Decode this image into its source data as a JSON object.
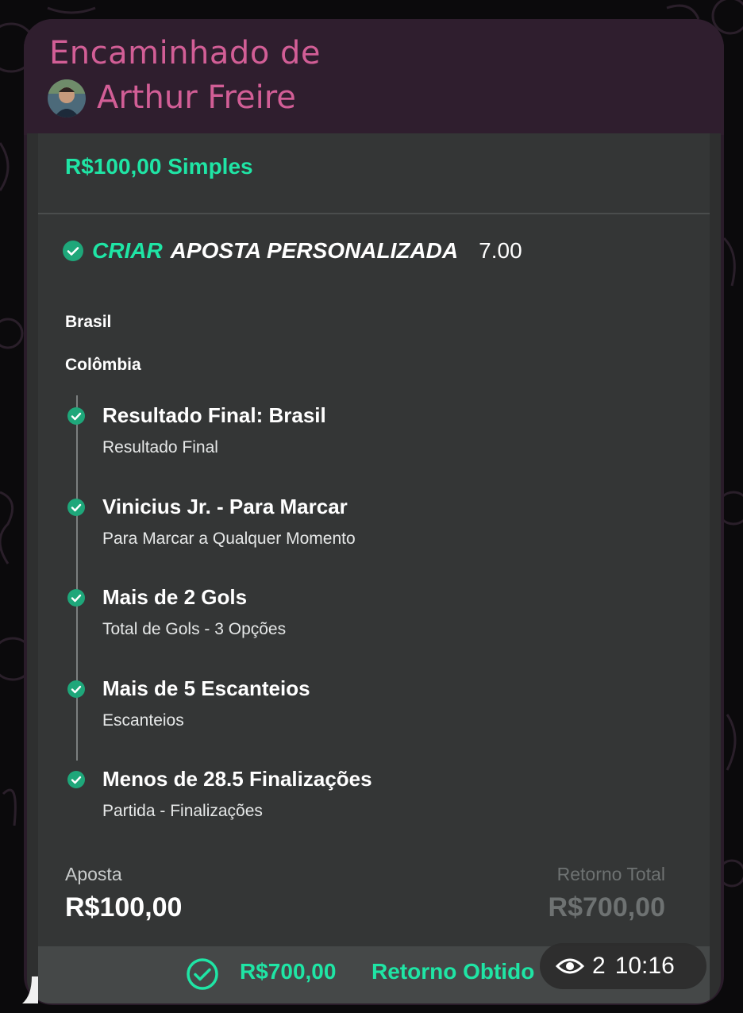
{
  "forward": {
    "label": "Encaminhado de",
    "author": "Arthur Freire",
    "avatar_icon": "user-avatar-photo"
  },
  "bet": {
    "stake_header": "R$100,00 Simples",
    "builder_prefix": "CRIAR",
    "builder_title": "APOSTA PERSONALIZADA",
    "odds": "7.00",
    "teams": [
      "Brasil",
      "Colômbia"
    ],
    "legs": [
      {
        "title": "Resultado Final: Brasil",
        "market": "Resultado Final"
      },
      {
        "title": "Vinicius Jr. - Para Marcar",
        "market": "Para Marcar a Qualquer Momento"
      },
      {
        "title": "Mais de 2 Gols",
        "market": "Total de Gols - 3 Opções"
      },
      {
        "title": "Mais de 5 Escanteios",
        "market": "Escanteios"
      },
      {
        "title": "Menos de 28.5 Finalizações",
        "market": "Partida - Finalizações"
      }
    ],
    "stake_label": "Aposta",
    "stake_value": "R$100,00",
    "return_label": "Retorno Total",
    "return_value": "R$700,00",
    "footer_amount": "R$700,00",
    "footer_text": "Retorno Obtido"
  },
  "meta": {
    "views": "2",
    "time": "10:16",
    "eye_icon": "eye-icon"
  },
  "colors": {
    "accent_green": "#1fe5a5",
    "forward_pink": "#d25e96",
    "check_green": "#1ea77a"
  }
}
